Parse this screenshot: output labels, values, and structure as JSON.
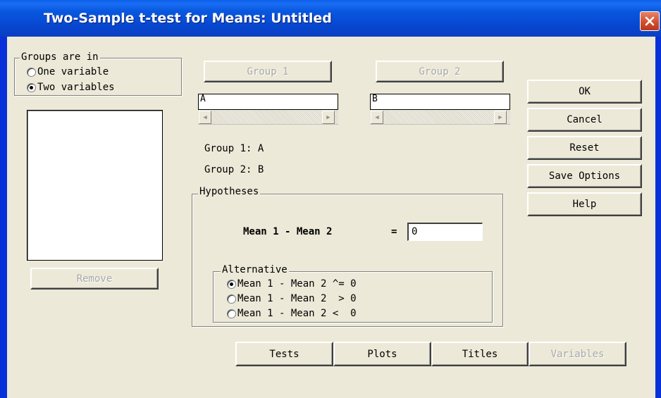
{
  "window": {
    "title": "Two-Sample t-test for Means: Untitled"
  },
  "groups_in": {
    "legend": "Groups are in",
    "options": [
      {
        "label": "One variable",
        "selected": false
      },
      {
        "label": "Two variables",
        "selected": true
      }
    ]
  },
  "left": {
    "remove_label": "Remove"
  },
  "group1": {
    "button_label": "Group 1",
    "value": "A",
    "summary": "Group 1: A"
  },
  "group2": {
    "button_label": "Group 2",
    "value": "B",
    "summary": "Group 2: B"
  },
  "hypotheses": {
    "legend": "Hypotheses",
    "mean_label": "Mean 1 - Mean 2",
    "equals": "=",
    "mean_value": "0",
    "alternative": {
      "legend": "Alternative",
      "options": [
        {
          "label": "Mean 1 - Mean 2 ^= 0",
          "selected": true
        },
        {
          "label": "Mean 1 - Mean 2  > 0",
          "selected": false
        },
        {
          "label": "Mean 1 - Mean 2 <  0",
          "selected": false
        }
      ]
    }
  },
  "actions": {
    "ok": "OK",
    "cancel": "Cancel",
    "reset": "Reset",
    "save_options": "Save Options",
    "help": "Help"
  },
  "bottom_tabs": {
    "tests": "Tests",
    "plots": "Plots",
    "titles": "Titles",
    "variables": "Variables"
  }
}
